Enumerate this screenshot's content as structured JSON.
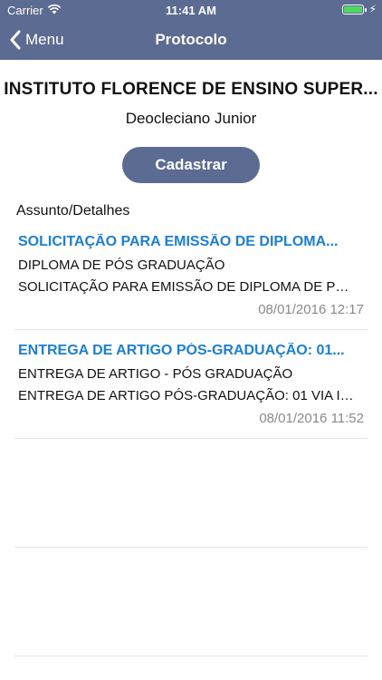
{
  "status_bar": {
    "carrier": "Carrier",
    "time": "11:41 AM",
    "wifi_icon": "wifi-icon",
    "battery_icon": "battery-icon",
    "charging_icon": "bolt-icon"
  },
  "nav": {
    "back_label": "Menu",
    "back_icon": "chevron-left-icon",
    "title": "Protocolo",
    "bar_color": "#5b6b92"
  },
  "header": {
    "institution": "INSTITUTO FLORENCE DE ENSINO SUPER...",
    "user": "Deocleciano Junior"
  },
  "actions": {
    "register_label": "Cadastrar",
    "button_color": "#5b6b92"
  },
  "list": {
    "label": "Assunto/Detalhes",
    "title_color": "#1b7fd6",
    "items": [
      {
        "title": "SOLICITAÇÃO PARA EMISSÃO DE DIPLOMA...",
        "subject": "DIPLOMA DE PÓS GRADUAÇÃO",
        "details": "SOLICITAÇÃO PARA EMISSÃO DE DIPLOMA DE PÓS...",
        "date": "08/01/2016 12:17"
      },
      {
        "title": "ENTREGA DE ARTIGO PÓS-GRADUAÇÃO: 01...",
        "subject": "ENTREGA DE ARTIGO - PÓS GRADUAÇÃO",
        "details": "ENTREGA DE ARTIGO PÓS-GRADUAÇÃO: 01 VIA IMP...",
        "date": "08/01/2016 11:52"
      }
    ]
  }
}
